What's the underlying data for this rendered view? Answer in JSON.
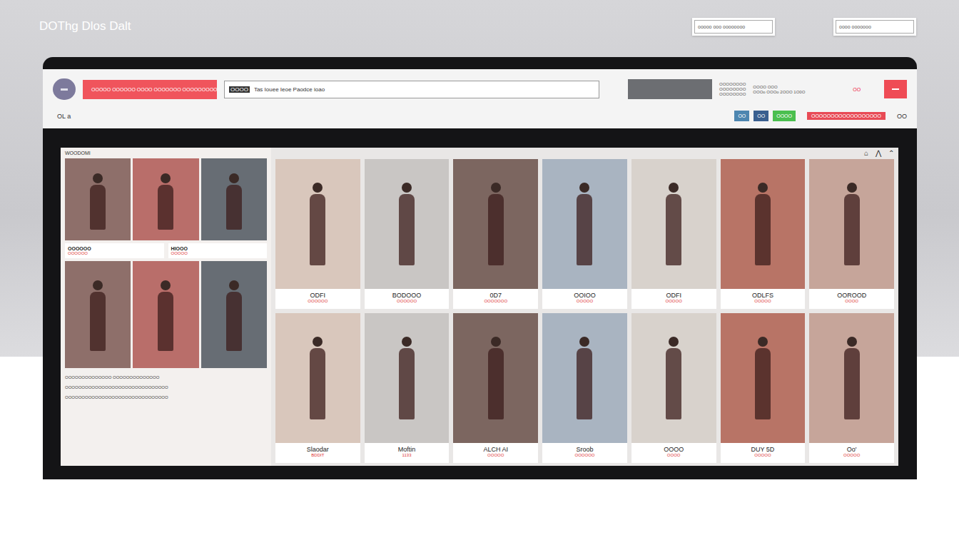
{
  "header": {
    "title": "DOThg Dlos Dalt",
    "fields": [
      "ooooo ooo oooooooo",
      "oooo ooooooo"
    ]
  },
  "toolbar": {
    "button": "OOOOO OOOOOO OOOO OOOOOOO OOOOOOOOO",
    "search": {
      "placeholder": "Tas Iouee Ieoe Paodce ioao",
      "prefix": "OOOO"
    },
    "info": [
      "OOOOOOOO",
      "OOOOOOOO",
      "OOOOOOOO"
    ],
    "account": [
      "OOOO OOO",
      "OOOo OOOo 2OOO 1O0O"
    ],
    "badge": "OO"
  },
  "filters": {
    "left": "OL a",
    "chips": [
      "OO",
      "OO",
      "OOOO"
    ],
    "sale": "OOOOOOOOOOOOOOOOOO",
    "right": "OO"
  },
  "gallery": {
    "panel": {
      "header": "WOODOMI",
      "captions": [
        {
          "title": "OOOOOO",
          "sub": "OOOOOO"
        },
        {
          "title": "HIOOO",
          "sub": "OOOOO"
        }
      ],
      "lines": [
        "OOOOOOOOOOOOOO  OOOOOOOOOOOOOO",
        "OOOOOOOOOOOOOOOOOOOOOOOOOOOOOOO",
        "OOOOOOOOOOOOOOOOOOOOOOOOOOOOOOO"
      ]
    },
    "icons": [
      "⌂",
      "⋀",
      "⌃"
    ],
    "cards": [
      {
        "title": "ODFI",
        "sub": "OOOOOO"
      },
      {
        "title": "BODOOO",
        "sub": "OOOOOO"
      },
      {
        "title": "0D7",
        "sub": "OOOOOOO"
      },
      {
        "title": "OOIOO",
        "sub": "OOOOO"
      },
      {
        "title": "ODFI",
        "sub": "OOOOO"
      },
      {
        "title": "ODLFS",
        "sub": "OOOOO"
      },
      {
        "title": "OOROOD",
        "sub": "OOOO"
      },
      {
        "title": "Slaodar",
        "sub": "BDDIT"
      },
      {
        "title": "Moftin",
        "sub": "1133"
      },
      {
        "title": "ALCH AI",
        "sub": "OOOOO"
      },
      {
        "title": "Sroob",
        "sub": "OOOOOO"
      },
      {
        "title": "OOOO",
        "sub": "OOOO"
      },
      {
        "title": "DUY 5D",
        "sub": "OOOOO"
      },
      {
        "title": "Oo'",
        "sub": "OOOOO"
      }
    ]
  }
}
